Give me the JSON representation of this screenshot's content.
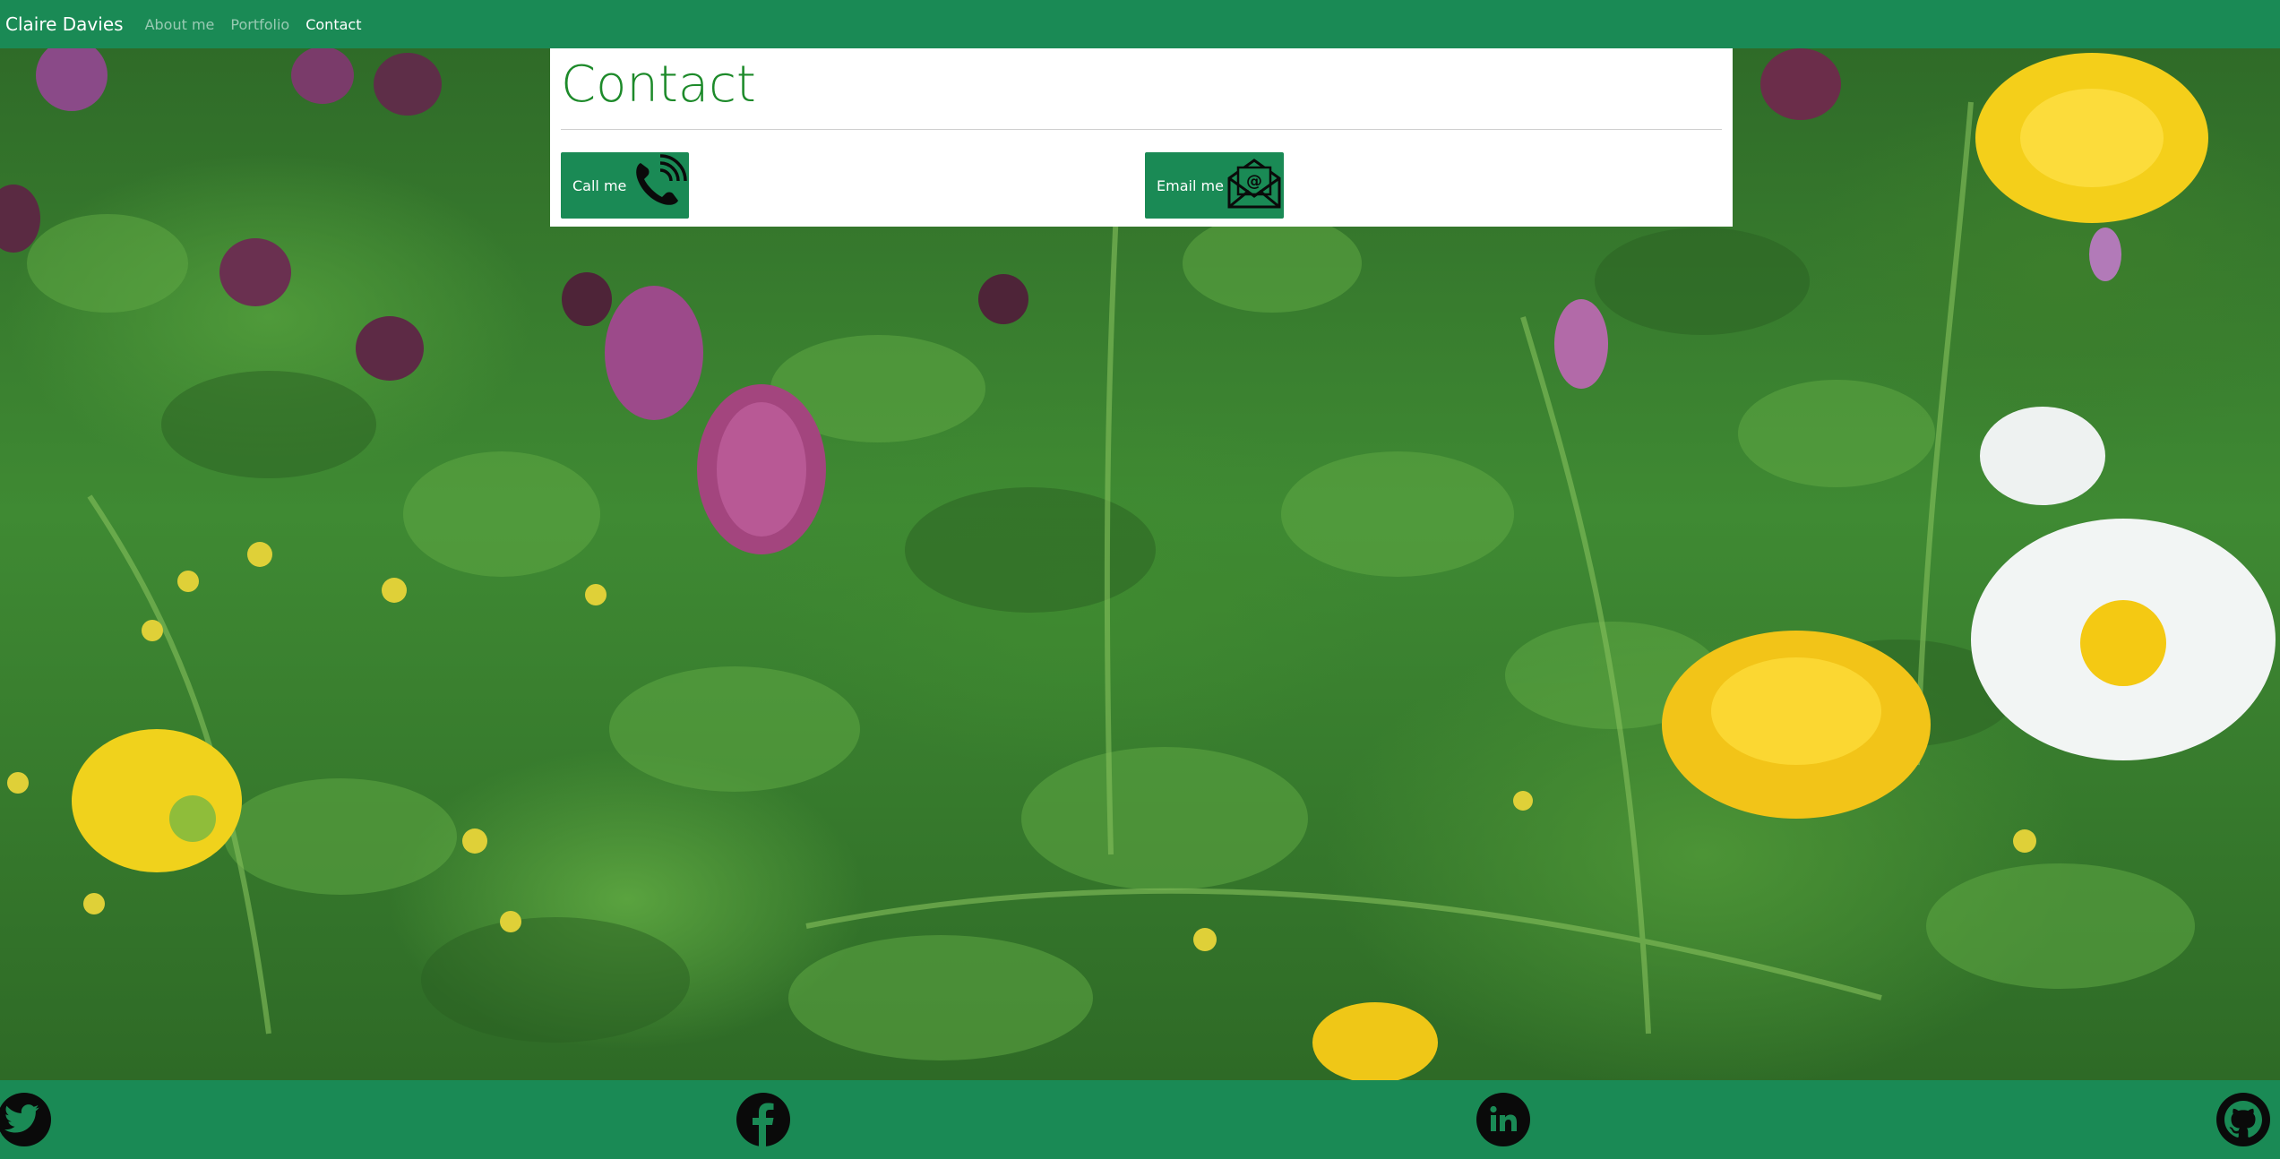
{
  "nav": {
    "brand": "Claire Davies",
    "links": [
      {
        "label": "About me"
      },
      {
        "label": "Portfolio"
      },
      {
        "label": "Contact"
      }
    ]
  },
  "contact": {
    "title": "Contact",
    "call_label": "Call me",
    "email_label": "Email me",
    "email_icon_glyph": "@"
  },
  "icons": {
    "call": "phone-icon",
    "email": "envelope-icon",
    "twitter": "twitter-icon",
    "facebook": "facebook-icon",
    "linkedin": "linkedin-icon",
    "github": "github-icon"
  },
  "colors": {
    "brand_green": "#1a8a55",
    "title_green": "#1d8a2a",
    "icon_dark": "#0a0a0a"
  }
}
